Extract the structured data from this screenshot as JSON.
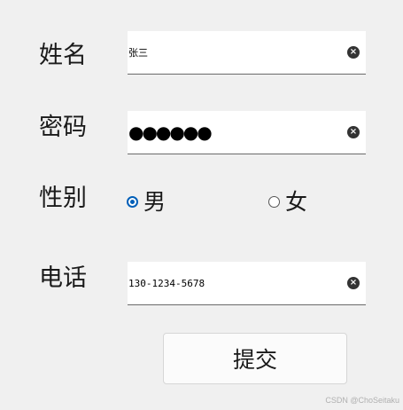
{
  "form": {
    "name": {
      "label": "姓名",
      "value": "张三"
    },
    "password": {
      "label": "密码",
      "value": "●●●●●●"
    },
    "gender": {
      "label": "性别",
      "options": [
        {
          "label": "男",
          "selected": true
        },
        {
          "label": "女",
          "selected": false
        }
      ]
    },
    "phone": {
      "label": "电话",
      "value": "130-1234-5678"
    },
    "clear_icon": "×",
    "submit_label": "提交"
  },
  "watermark": "CSDN @ChoSeitaku",
  "colors": {
    "accent": "#005fb8",
    "background": "#f0f0f0"
  }
}
